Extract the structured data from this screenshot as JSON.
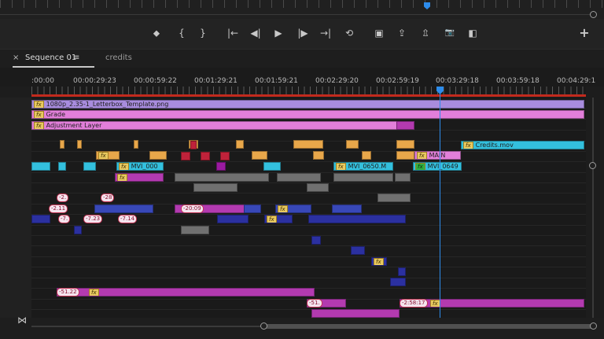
{
  "transport": {
    "buttons": [
      {
        "name": "add-marker-button",
        "glyph": "⬥"
      },
      {
        "name": "mark-in-button",
        "glyph": "{"
      },
      {
        "name": "mark-out-button",
        "glyph": "}"
      },
      {
        "name": "go-to-in-button",
        "glyph": "|←"
      },
      {
        "name": "step-back-button",
        "glyph": "◀|"
      },
      {
        "name": "play-button",
        "glyph": "▶"
      },
      {
        "name": "step-forward-button",
        "glyph": "|▶"
      },
      {
        "name": "go-to-out-button",
        "glyph": "→|"
      },
      {
        "name": "loop-button",
        "glyph": "⟲"
      },
      {
        "name": "safe-margins-button",
        "glyph": "▣"
      },
      {
        "name": "lift-button",
        "glyph": "⇪"
      },
      {
        "name": "extract-button",
        "glyph": "⇫"
      },
      {
        "name": "export-frame-button",
        "glyph": "📷"
      },
      {
        "name": "comparison-view-button",
        "glyph": "◧"
      },
      {
        "name": "button-editor-add",
        "glyph": "+"
      }
    ]
  },
  "tabs": {
    "close_glyph": "×",
    "active": "Sequence 01",
    "menu_glyph": "≡",
    "inactive": "credits"
  },
  "timecodes": [
    ":00:00",
    "00:00:29:23",
    "00:00:59:22",
    "00:01:29:21",
    "00:01:59:21",
    "00:02:29:20",
    "00:02:59:19",
    "00:03:29:18",
    "00:03:59:18",
    "00:04:29:1"
  ],
  "clips": {
    "letterbox": "1080p_2.35-1_Letterbox_Template.png",
    "grade": "Grade",
    "adjustment": "Adjustment Layer",
    "credits": "Credits.mov",
    "main": "MAIN",
    "mvi_000": "MVI_000",
    "mvi_0650": "MVI_0650.M",
    "mvi_0649": "MVI_0649"
  },
  "fx_label": "fx",
  "durations": {
    "d1": "-20:09",
    "d2": "-2.11",
    "d3": "-7.",
    "d4": "-7.23",
    "d5": "-7.14",
    "d6": "-51.22",
    "d7": "-2:58:17",
    "d8": "-51.",
    "d9": "-2.",
    "d10": "-28"
  },
  "footer": {
    "zoom_glyph": "⋈"
  }
}
